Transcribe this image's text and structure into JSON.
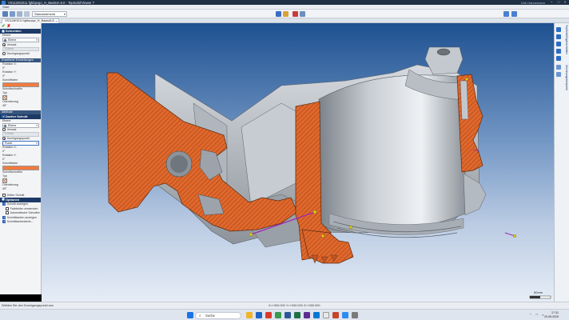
{
  "window": {
    "title": "VS1128G011 fgkbpvgo_H_BasisIA 8.0 - TopSolid'Viewer 7",
    "user": "Dirk Hannemann",
    "minimize": "–",
    "maximize": "□",
    "close": "×"
  },
  "menu": {
    "start": "Start"
  },
  "toolbar": {
    "view_dropdown": "Standardmenü"
  },
  "document_tab": {
    "label": "VS1128G011 fgkbpvgo_H_BasisIA 8...",
    "close": "×"
  },
  "panel": {
    "ok": "✔",
    "cancel": "✘",
    "section_cut": "Schneiden",
    "plane_label": "Ebene",
    "plane_value": "Ebene",
    "option_normal": "Versatz",
    "offset_value": "0,0mm",
    "option_point": "Durchgangspunkt",
    "extended_settings": "Erweiterte Einstellungen",
    "rotation_x_label": "Rotation X:",
    "rotation_x_value": "0°",
    "rotation_y_label": "Rotation Y:",
    "rotation_y_value": "0°",
    "cut_color_label": "Schnittfarbe",
    "hatch_label": "Schnittschraffur",
    "type_label": "Typ",
    "orientation_label": "Orientierung",
    "orientation_value": "45°",
    "section_attributes": "Attribute",
    "section_second_cut": "Zweiter Schnitt",
    "plane2_label": "Ebene",
    "plane2_value": "Ebene",
    "offset2_label": "Versatz",
    "offset2_value": "0,0mm",
    "point2_label": "Durchgangspunkt",
    "point2_value": "Punkt",
    "rotation_x2_label": "Rotation X:",
    "rotation_x2_value": "0°",
    "rotation_y2_label": "Rotation Y:",
    "rotation_y2_value": "0°",
    "cut_color2_label": "Schnittfarbe",
    "hatch2_label": "Schnittschraffur",
    "type2_label": "Typ",
    "orientation2_label": "Orientierung",
    "orientation2_value": "45°",
    "third_cut": "Dritter Schnitt",
    "section_options": "Optionen",
    "opt_show_cut": "Schnitt anzeigen",
    "opt_use_parts": "Farbfelder verwenden",
    "opt_auto_hatch": "Automatische Schraffur",
    "opt_show_edges": "Schnittkanten anzeigen",
    "opt_edge_colors": "Schnittkantenfarbe..."
  },
  "viewport": {
    "scale_label": "50mm"
  },
  "status": {
    "hint": "Wählen Sie den Durchgangspunkt aus",
    "coord_x": "X=+000.000",
    "coord_y": "Y=+000.000",
    "coord_z": "Z=+000.000"
  },
  "taskbar": {
    "search_placeholder": "Suche",
    "time": "17:31",
    "date": "29.08.2025"
  },
  "right_tabs": [
    "TopSolid Eigenschaften",
    "Zeichnungsbeispiele"
  ],
  "colors": {
    "cut_color": "#f07b3f",
    "background_top": "#1e5191",
    "background_bottom": "#e6edf6",
    "accent": "#1d3a66"
  }
}
